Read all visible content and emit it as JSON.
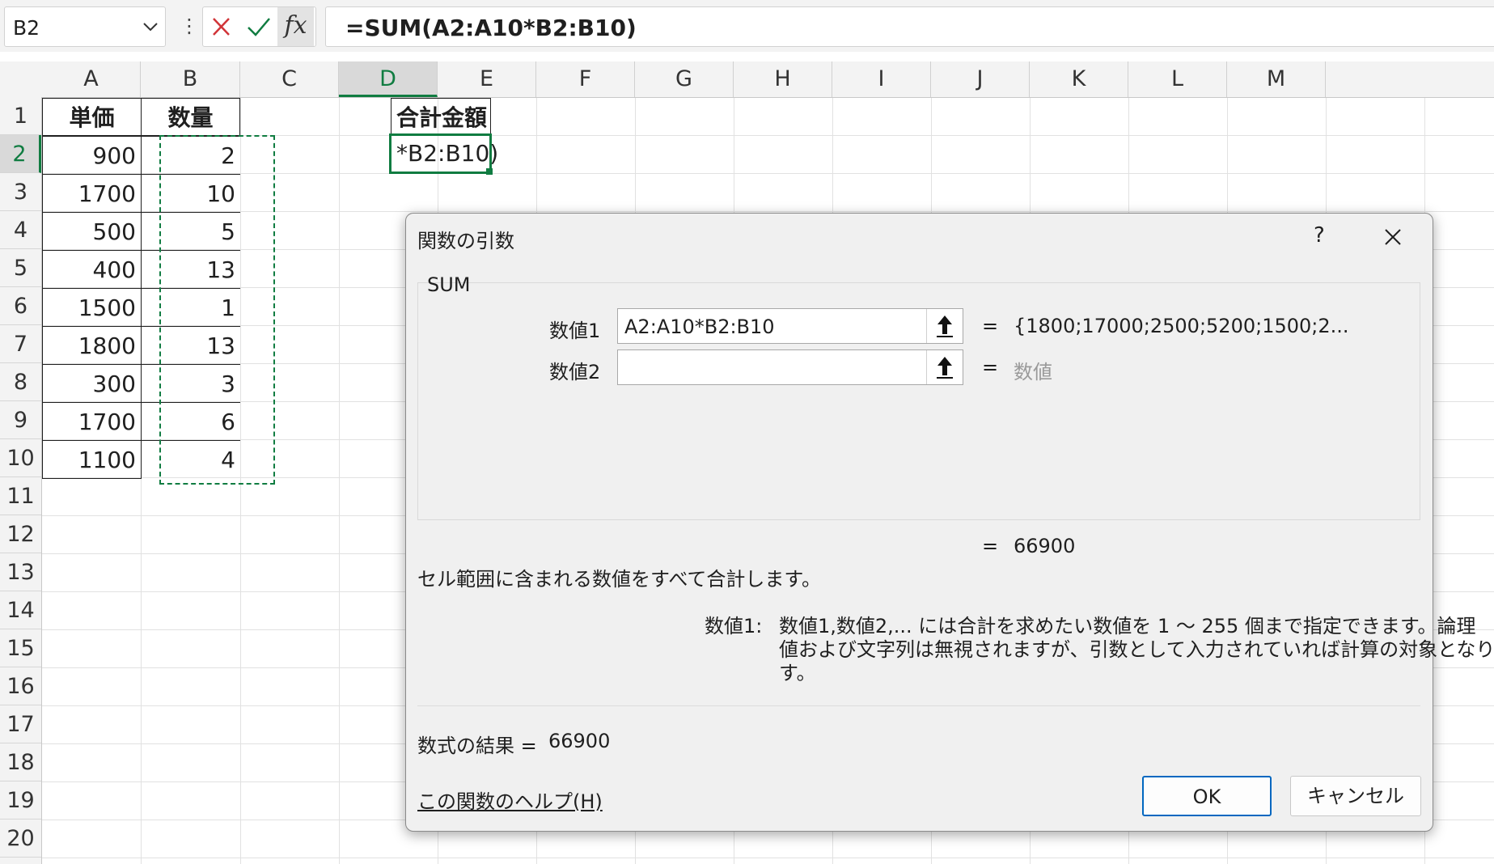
{
  "formula_bar": {
    "name_box": "B2",
    "formula": "=SUM(A2:A10*B2:B10)",
    "fx_label": "fx",
    "cancel_icon": "x-icon",
    "enter_icon": "check-icon"
  },
  "columns": [
    "A",
    "B",
    "C",
    "D",
    "E",
    "F",
    "G",
    "H",
    "I",
    "J",
    "K",
    "L",
    "M"
  ],
  "rows": [
    "1",
    "2",
    "3",
    "4",
    "5",
    "6",
    "7",
    "8",
    "9",
    "10",
    "11",
    "12",
    "13",
    "14",
    "15",
    "16",
    "17",
    "18",
    "19",
    "20"
  ],
  "selected_column": "D",
  "selected_row": "2",
  "sheet": {
    "A1": "単価",
    "B1": "数量",
    "D1": "合計金額",
    "D2": "*B2:B10)",
    "prices": [
      "900",
      "1700",
      "500",
      "400",
      "1500",
      "1800",
      "300",
      "1700",
      "1100"
    ],
    "quantities": [
      "2",
      "10",
      "5",
      "13",
      "1",
      "13",
      "3",
      "6",
      "4"
    ]
  },
  "dialog": {
    "title": "関数の引数",
    "help_symbol": "?",
    "function_name": "SUM",
    "arg1_label": "数値1",
    "arg1_value": "A2:A10*B2:B10",
    "arg1_result": "{1800;17000;2500;5200;1500;2...",
    "arg2_label": "数値2",
    "arg2_value": "",
    "arg2_result": "数値",
    "equals": "=",
    "function_result": "66900",
    "description": "セル範囲に含まれる数値をすべて合計します。",
    "arg_help_label": "数値1:",
    "arg_help_text_1": "数値1,数値2,... には合計を求めたい数値を 1 〜 255 個まで指定できます。論理",
    "arg_help_text_2": "値および文字列は無視されますが、引数として入力されていれば計算の対象となりま",
    "arg_help_text_3": "す。",
    "formula_result_label": "数式の結果 =",
    "formula_result_value": "66900",
    "help_link": "この関数のヘルプ(H)",
    "ok_label": "OK",
    "cancel_label": "キャンセル"
  },
  "colors": {
    "accent": "#107c41",
    "link": "#0067c0",
    "error": "#d13438"
  }
}
